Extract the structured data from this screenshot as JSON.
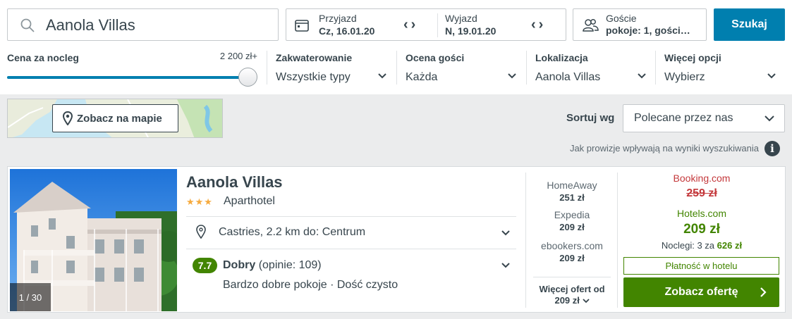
{
  "search": {
    "value": "Aanola Villas",
    "icon": "search-icon"
  },
  "dates": {
    "checkin_label": "Przyjazd",
    "checkin_value": "Cz, 16.01.20",
    "checkout_label": "Wyjazd",
    "checkout_value": "N, 19.01.20"
  },
  "guests": {
    "label": "Goście",
    "value": "pokoje: 1, gości…"
  },
  "search_button": "Szukaj",
  "filters": {
    "price": {
      "label": "Cena za nocleg",
      "max": "2 200 zł+",
      "slider_level": 1.0
    },
    "accommodation": {
      "label": "Zakwaterowanie",
      "value": "Wszystkie typy"
    },
    "rating": {
      "label": "Ocena gości",
      "value": "Każda"
    },
    "location": {
      "label": "Lokalizacja",
      "value": "Aanola Villas"
    },
    "more": {
      "label": "Więcej opcji",
      "value": "Wybierz"
    }
  },
  "map": {
    "button_label": "Zobacz na mapie"
  },
  "sort": {
    "label": "Sortuj wg",
    "value": "Polecane przez nas"
  },
  "commission_note": "Jak prowizje wpływają na wyniki wyszukiwania",
  "hotel": {
    "name": "Aanola Villas",
    "stars": 3,
    "stars_text": "★★★",
    "type": "Aparthotel",
    "location": "Castries, 2.2 km do: Centrum",
    "rating_score": "7.7",
    "rating_word": "Dobry",
    "rating_count": "(opinie: 109)",
    "rating_desc": "Bardzo dobre pokoje · Dość czysto",
    "photo_counter": "1 / 30",
    "other_offers": [
      {
        "site": "HomeAway",
        "price": "251 zł"
      },
      {
        "site": "Expedia",
        "price": "209 zł"
      },
      {
        "site": "ebookers.com",
        "price": "209 zł"
      }
    ],
    "more_offers_line1": "Więcej ofert od",
    "more_offers_line2": "209 zł",
    "strike_site": "Booking.com",
    "strike_price": "259 zł",
    "best_site": "Hotels.com",
    "best_price": "209 zł",
    "nights_prefix": "Noclegi: 3 za",
    "nights_total": "626 zł",
    "pay_at_hotel": "Płatność w hotelu",
    "deal_button": "Zobacz ofertę"
  },
  "colors": {
    "accent_blue": "#007faf",
    "deal_green": "#428500",
    "strike_red": "#c4383b",
    "star_orange": "#f6ab3f",
    "text": "#37454d"
  }
}
